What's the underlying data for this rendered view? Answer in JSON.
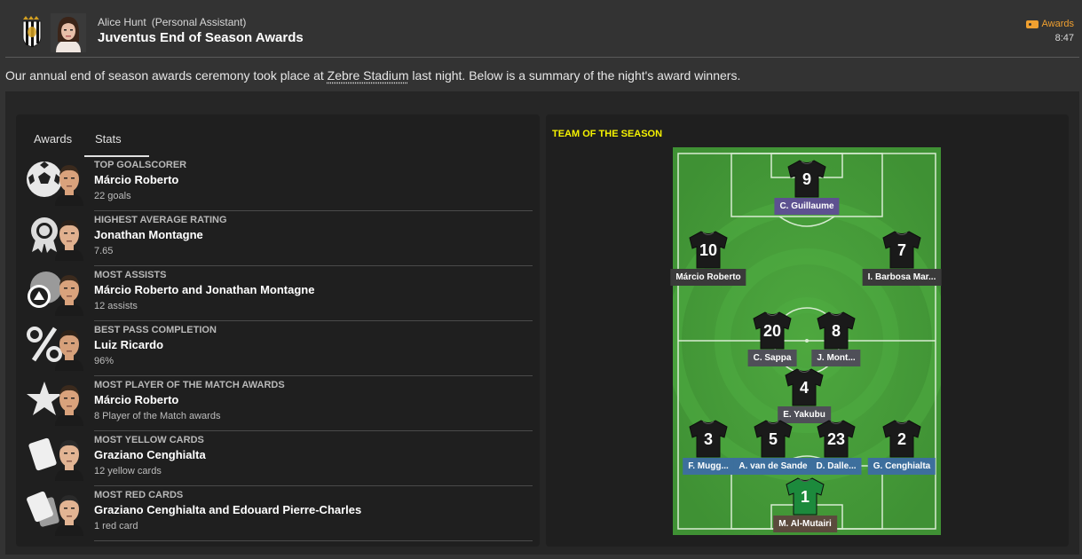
{
  "header": {
    "sender_name": "Alice Hunt",
    "sender_role": "(Personal Assistant)",
    "title": "Juventus End of Season Awards",
    "tag": "Awards",
    "time": "8:47"
  },
  "intro": {
    "before": "Our annual end of season awards ceremony took place at ",
    "link": "Zebre Stadium",
    "after": " last night. Below is a summary of the night's award winners."
  },
  "tabs": [
    {
      "label": "Awards",
      "active": false
    },
    {
      "label": "Stats",
      "active": true
    }
  ],
  "stats": [
    {
      "category": "TOP GOALSCORER",
      "winner": "Márcio Roberto",
      "value": "22 goals",
      "icon": "football-icon"
    },
    {
      "category": "HIGHEST AVERAGE RATING",
      "winner": "Jonathan Montagne",
      "value": "7.65",
      "icon": "rating-badge-icon"
    },
    {
      "category": "MOST ASSISTS",
      "winner": "Márcio Roberto and Jonathan Montagne",
      "value": "12 assists",
      "icon": "assist-icon"
    },
    {
      "category": "BEST PASS COMPLETION",
      "winner": "Luiz Ricardo",
      "value": "96%",
      "icon": "percent-icon"
    },
    {
      "category": "MOST PLAYER OF THE MATCH AWARDS",
      "winner": "Márcio Roberto",
      "value": "8 Player of the Match awards",
      "icon": "star-icon"
    },
    {
      "category": "MOST YELLOW CARDS",
      "winner": "Graziano Cenghialta",
      "value": "12 yellow cards",
      "icon": "card-icon"
    },
    {
      "category": "MOST RED CARDS",
      "winner": "Graziano Cenghialta and Edouard Pierre-Charles",
      "value": "1 red card",
      "icon": "cards-icon"
    }
  ],
  "team_of_season": {
    "title": "TEAM OF THE SEASON",
    "players": [
      {
        "number": "9",
        "name": "C. Guillaume",
        "role": "striker"
      },
      {
        "number": "10",
        "name": "Márcio Roberto",
        "role": "left-winger"
      },
      {
        "number": "7",
        "name": "I. Barbosa Mar...",
        "role": "right-winger"
      },
      {
        "number": "20",
        "name": "C. Sappa",
        "role": "central-midfielder"
      },
      {
        "number": "8",
        "name": "J. Mont...",
        "role": "central-midfielder"
      },
      {
        "number": "4",
        "name": "E. Yakubu",
        "role": "defensive-midfielder"
      },
      {
        "number": "3",
        "name": "F. Mugg...",
        "role": "left-back"
      },
      {
        "number": "5",
        "name": "A. van de Sande",
        "role": "centre-back"
      },
      {
        "number": "23",
        "name": "D. Dalle...",
        "role": "centre-back"
      },
      {
        "number": "2",
        "name": "G. Cenghialta",
        "role": "right-back"
      },
      {
        "number": "1",
        "name": "M. Al-Mutairi",
        "role": "goalkeeper"
      }
    ]
  },
  "colors": {
    "tots_title": "#f5f200",
    "tag": "#f0a030",
    "pitch_green": "#4a9e3c",
    "label_blue": "#3d6f9d",
    "label_purple": "#5d5190"
  }
}
